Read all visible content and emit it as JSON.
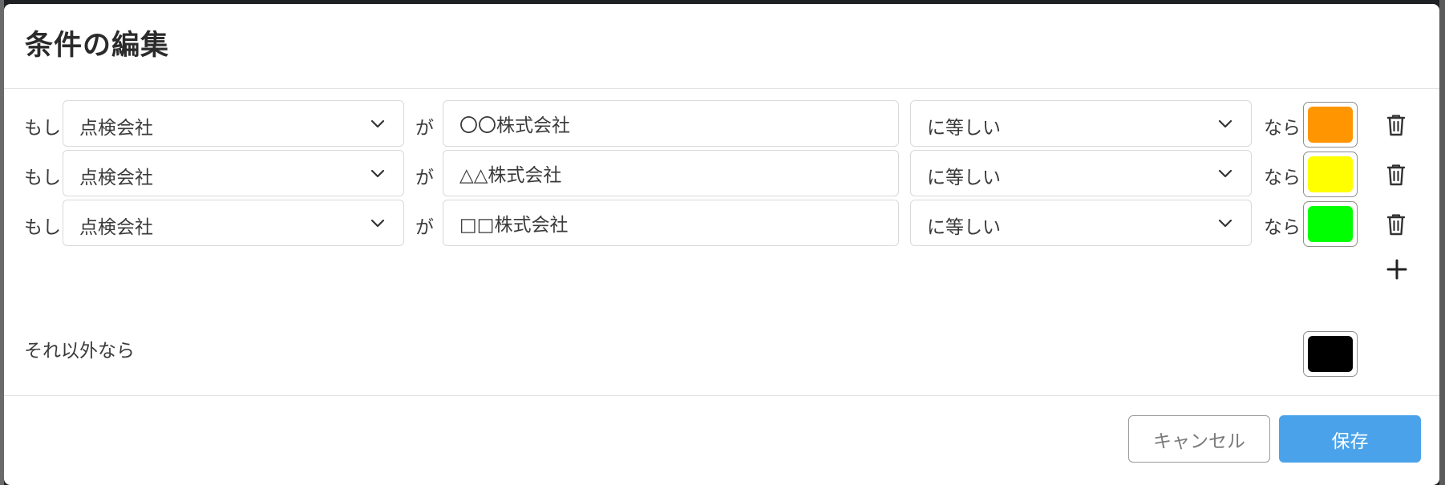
{
  "dialog": {
    "title": "条件の編集"
  },
  "rules": [
    {
      "prefix": "もし",
      "field": "点検会社",
      "particle": "が",
      "value": "〇〇株式会社",
      "operator": "に等しい",
      "suffix": "なら",
      "color": "#ff9500"
    },
    {
      "prefix": "もし",
      "field": "点検会社",
      "particle": "が",
      "value": "△△株式会社",
      "operator": "に等しい",
      "suffix": "なら",
      "color": "#ffff00"
    },
    {
      "prefix": "もし",
      "field": "点検会社",
      "particle": "が",
      "value": "□□株式会社",
      "operator": "に等しい",
      "suffix": "なら",
      "color": "#00ff00"
    }
  ],
  "else_rule": {
    "label": "それ以外なら",
    "color": "#000000"
  },
  "icons": {
    "row_action": "trash-icon",
    "add": "plus-icon",
    "dropdown": "chevron-down-icon"
  },
  "footer": {
    "cancel_label": "キャンセル",
    "save_label": "保存"
  },
  "colors": {
    "primary": "#4aa3ea"
  }
}
